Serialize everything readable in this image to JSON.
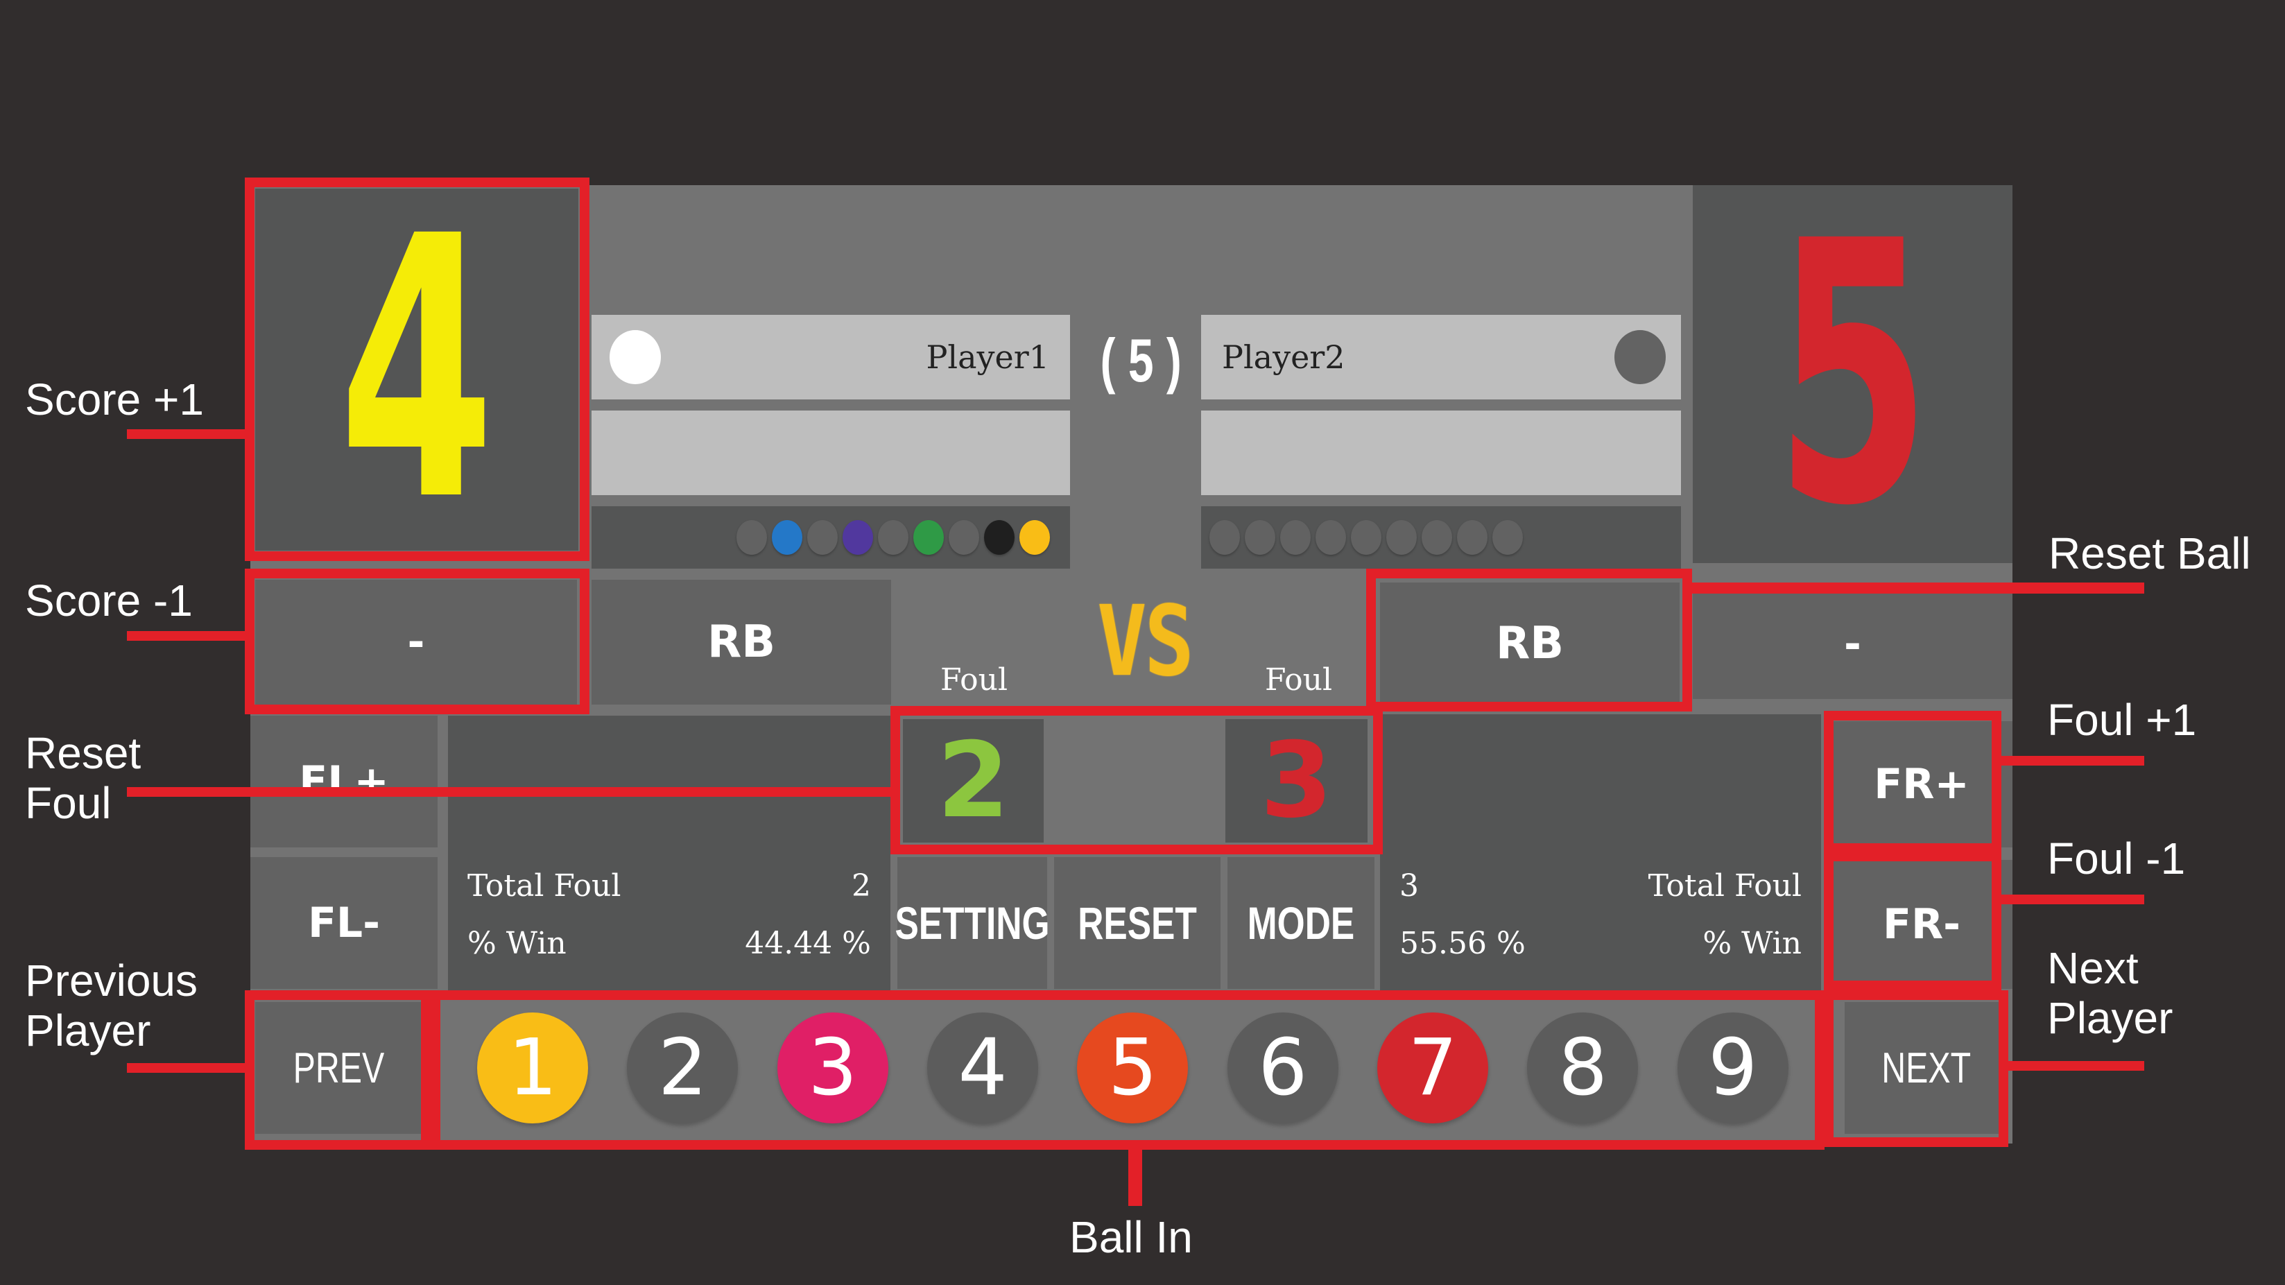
{
  "scoreboard": {
    "rack_label": "( 5 )",
    "vs_label": "VS",
    "colors": {
      "player1_score": "#f5ec07",
      "player2_score": "#d3262d",
      "player1_foul": "#8cc63f",
      "player2_foul": "#d3262d",
      "vs_text": "#f4bb1c",
      "annotation": "#e32028"
    },
    "player1": {
      "name": "Player1",
      "score": "4",
      "turn_indicator": "white",
      "foul_label": "Foul",
      "foul_count": "2",
      "total_foul_label": "Total Foul",
      "total_foul_value": "2",
      "win_label": "% Win",
      "win_value": "44.44 %",
      "pocketed_balls": [
        {
          "color": "#626262",
          "pocketed": false
        },
        {
          "color": "#2478c8",
          "pocketed": true
        },
        {
          "color": "#626262",
          "pocketed": false
        },
        {
          "color": "#51389e",
          "pocketed": true
        },
        {
          "color": "#626262",
          "pocketed": false
        },
        {
          "color": "#2f9a46",
          "pocketed": true
        },
        {
          "color": "#626262",
          "pocketed": false
        },
        {
          "color": "#1f1f1f",
          "pocketed": true
        },
        {
          "color": "#f9bd16",
          "pocketed": true
        }
      ]
    },
    "player2": {
      "name": "Player2",
      "score": "5",
      "turn_indicator": "gray",
      "foul_label": "Foul",
      "foul_count": "3",
      "total_foul_label": "Total Foul",
      "total_foul_value": "3",
      "win_label": "% Win",
      "win_value": "55.56 %",
      "pocketed_balls": [
        {
          "color": "#626262",
          "pocketed": false
        },
        {
          "color": "#626262",
          "pocketed": false
        },
        {
          "color": "#626262",
          "pocketed": false
        },
        {
          "color": "#626262",
          "pocketed": false
        },
        {
          "color": "#626262",
          "pocketed": false
        },
        {
          "color": "#626262",
          "pocketed": false
        },
        {
          "color": "#626262",
          "pocketed": false
        },
        {
          "color": "#626262",
          "pocketed": false
        },
        {
          "color": "#626262",
          "pocketed": false
        }
      ]
    }
  },
  "controls": {
    "left_minus": "-",
    "left_rb": "RB",
    "right_rb": "RB",
    "right_minus": "-",
    "fl_plus": "FL+",
    "fl_minus": "FL-",
    "fr_plus": "FR+",
    "fr_minus": "FR-",
    "setting": "SETTING",
    "reset": "RESET",
    "mode": "MODE",
    "prev": "PREV",
    "next": "NEXT"
  },
  "ball_buttons": [
    {
      "number": "1",
      "color": "#f9bd16"
    },
    {
      "number": "2",
      "color": "#5c5c5c"
    },
    {
      "number": "3",
      "color": "#e01f66"
    },
    {
      "number": "4",
      "color": "#5c5c5c"
    },
    {
      "number": "5",
      "color": "#e6491f"
    },
    {
      "number": "6",
      "color": "#5c5c5c"
    },
    {
      "number": "7",
      "color": "#d3262d"
    },
    {
      "number": "8",
      "color": "#5c5c5c"
    },
    {
      "number": "9",
      "color": "#5c5c5c"
    }
  ],
  "annotations": {
    "score_plus": "Score +1",
    "score_minus": "Score -1",
    "reset_foul": [
      "Reset",
      "Foul"
    ],
    "previous_player": [
      "Previous",
      "Player"
    ],
    "reset_ball": "Reset Ball",
    "foul_plus": "Foul +1",
    "foul_minus": "Foul -1",
    "next_player": [
      "Next",
      "Player"
    ],
    "ball_in": "Ball In"
  }
}
